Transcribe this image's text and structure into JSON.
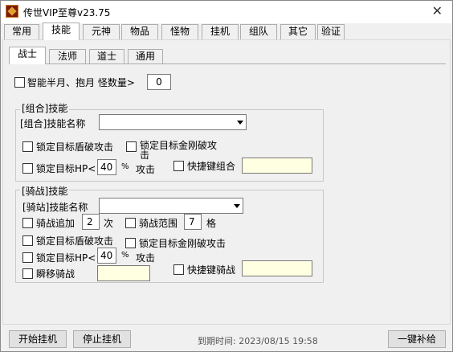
{
  "window": {
    "title": "传世VIP至尊v23.75",
    "close_label": "✕"
  },
  "tabs": [
    "常用",
    "技能",
    "元神",
    "物品",
    "怪物",
    "挂机",
    "组队",
    "其它",
    "验证"
  ],
  "subtabs": [
    "战士",
    "法师",
    "道士",
    "通用"
  ],
  "top_option": {
    "label": "智能半月、抱月 怪数量>",
    "value": "0"
  },
  "combo_group": {
    "title": "[组合]技能",
    "skill_name_label": "[组合]技能名称",
    "lock_shield_label": "锁定目标盾破攻击",
    "lock_diamond_label_1": "锁定目标金刚破攻",
    "lock_diamond_label_2": "击",
    "lock_hp_label": "锁定目标HP<",
    "lock_hp_value": "40",
    "percent_label": "%",
    "attack_label": "攻击",
    "hotkey_label": "快捷键组合",
    "hotkey_value": ""
  },
  "ride_group": {
    "title": "[骑战]技能",
    "skill_name_label": "[骑站]技能名称",
    "extra_label": "骑战追加",
    "extra_value": "2",
    "times_label": "次",
    "range_label": "骑战范围",
    "range_value": "7",
    "grid_label": "格",
    "lock_shield_label": "锁定目标盾破攻击",
    "lock_diamond_label": "锁定目标金刚破攻击",
    "lock_hp_label": "锁定目标HP<",
    "lock_hp_value": "40",
    "percent_label": "%",
    "attack_label": "攻击",
    "teleport_label": "瞬移骑战",
    "teleport_value": "",
    "hotkey_label": "快捷键骑战",
    "hotkey_value": ""
  },
  "footer": {
    "start_label": "开始挂机",
    "stop_label": "停止挂机",
    "expire_text": "到期时间: 2023/08/15 19:58",
    "supply_label": "一键补给"
  }
}
